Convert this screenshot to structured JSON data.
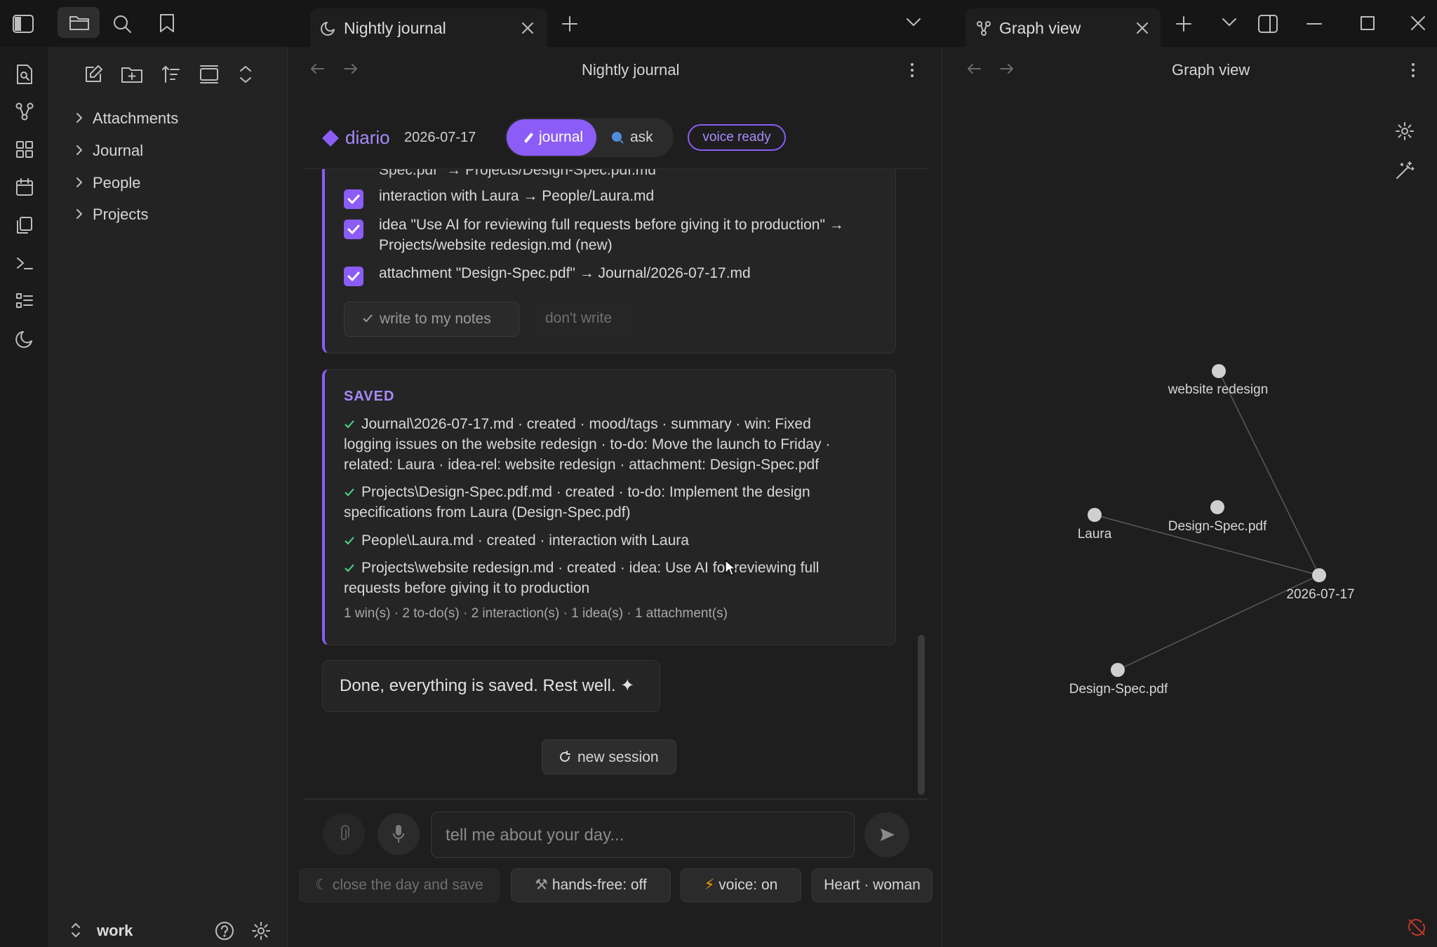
{
  "titlebar": {
    "left_tab_title": "Nightly journal",
    "right_tab_title": "Graph view"
  },
  "sidebar": {
    "items": [
      {
        "label": "Attachments"
      },
      {
        "label": "Journal"
      },
      {
        "label": "People"
      },
      {
        "label": "Projects"
      }
    ],
    "vault_name": "work"
  },
  "main": {
    "header_title": "Nightly journal",
    "brand": "diario",
    "date": "2026-07-17",
    "mode_journal": "journal",
    "mode_ask": "ask",
    "voice_badge": "voice ready",
    "cut_line": "Spec.pdf\" → Projects/Design-Spec.pdf.md",
    "proposals": [
      {
        "text": "interaction with Laura → People/Laura.md"
      },
      {
        "text": "idea \"Use AI for reviewing full requests before giving it to production\" →",
        "text2": "Projects/website redesign.md (new)"
      },
      {
        "text": "attachment \"Design-Spec.pdf\" → Journal/2026-07-17.md"
      }
    ],
    "write_btn": "write to my notes",
    "dont_write_btn": "don't write",
    "saved_heading": "SAVED",
    "saved_lines": [
      "Journal\\2026-07-17.md · created · mood/tags · summary · win: Fixed",
      "logging issues on the website redesign · to-do: Move the launch to Friday ·",
      "related: Laura · idea-rel: website redesign · attachment: Design-Spec.pdf",
      "Projects\\Design-Spec.pdf.md · created · to-do: Implement the design",
      "specifications from Laura (Design-Spec.pdf)",
      "People\\Laura.md · created · interaction with Laura",
      "Projects\\website redesign.md · created · idea: Use AI for reviewing full",
      "requests before giving it to production"
    ],
    "saved_summary": "1 win(s) · 2 to-do(s) · 2 interaction(s) · 1 idea(s) · 1 attachment(s)",
    "assistant_message": "Done, everything is saved. Rest well. ✦",
    "new_session_btn": "new session",
    "input_placeholder": "tell me about your day...",
    "bottom_buttons": {
      "close_day": "close the day and save",
      "hands_free": "hands-free: off",
      "voice": "voice: on",
      "voice_name": "Heart · woman"
    }
  },
  "graph": {
    "title": "Graph view",
    "nodes": [
      {
        "label": "website redesign"
      },
      {
        "label": "Laura"
      },
      {
        "label": "Design-Spec.pdf"
      },
      {
        "label": "2026-07-17"
      },
      {
        "label": "Design-Spec.pdf"
      }
    ]
  },
  "colors": {
    "accent": "#8b5cf6",
    "accent_light": "#a78bfa",
    "saved_check": "#4ade80"
  }
}
